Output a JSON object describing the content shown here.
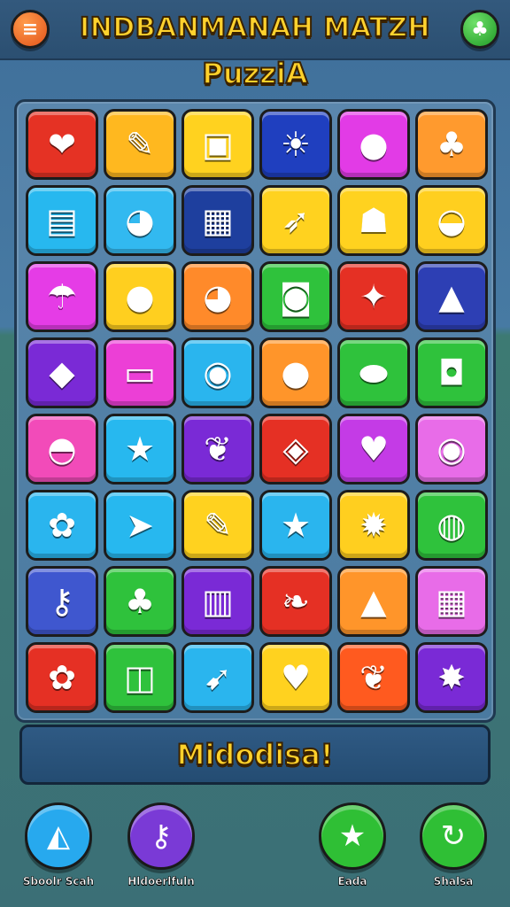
{
  "header": {
    "title": "INDBANMANAH MATZH",
    "subtitle": "PuzziA",
    "menu_icon": "≡",
    "profile_icon": "♣"
  },
  "board": {
    "tiles": [
      {
        "name": "heart-bow-icon",
        "glyph": "❤",
        "bg": "#e53224"
      },
      {
        "name": "pencil-icon",
        "glyph": "✎",
        "bg": "#ffb81f"
      },
      {
        "name": "camera-icon",
        "glyph": "▣",
        "bg": "#ffd21f"
      },
      {
        "name": "sun-icon",
        "glyph": "☀",
        "bg": "#1f3fbf"
      },
      {
        "name": "balloon-icon",
        "glyph": "●",
        "bg": "#e23be6"
      },
      {
        "name": "palm-tree-icon",
        "glyph": "♣",
        "bg": "#ff9a2e"
      },
      {
        "name": "treasure-box-icon",
        "glyph": "▤",
        "bg": "#27b8ef"
      },
      {
        "name": "fish-face-icon",
        "glyph": "◕",
        "bg": "#32b9f0"
      },
      {
        "name": "robot-head-icon",
        "glyph": "▦",
        "bg": "#1e3f9e"
      },
      {
        "name": "rocket-icon",
        "glyph": "➶",
        "bg": "#ffd21f"
      },
      {
        "name": "robot-icon",
        "glyph": "☗",
        "bg": "#ffd21f"
      },
      {
        "name": "melon-slice-icon",
        "glyph": "◒",
        "bg": "#ffcf1f"
      },
      {
        "name": "umbrella-icon",
        "glyph": "☂",
        "bg": "#e53ce6"
      },
      {
        "name": "bear-face-icon",
        "glyph": "●",
        "bg": "#ffcf1f"
      },
      {
        "name": "fish-face-icon",
        "glyph": "◕",
        "bg": "#ff8a2a"
      },
      {
        "name": "pot-icon",
        "glyph": "◙",
        "bg": "#2fc23c"
      },
      {
        "name": "star-sword-icon",
        "glyph": "✦",
        "bg": "#e53024"
      },
      {
        "name": "frog-icon",
        "glyph": "▲",
        "bg": "#2d3fb4"
      },
      {
        "name": "crystal-icon",
        "glyph": "◆",
        "bg": "#7a2ad6"
      },
      {
        "name": "tv-icon",
        "glyph": "▭",
        "bg": "#ec3fd6"
      },
      {
        "name": "fish-icon",
        "glyph": "◉",
        "bg": "#2ab5ee"
      },
      {
        "name": "balloon-icon",
        "glyph": "●",
        "bg": "#ff952a"
      },
      {
        "name": "capsule-icon",
        "glyph": "⬬",
        "bg": "#2fc23c"
      },
      {
        "name": "purse-icon",
        "glyph": "◘",
        "bg": "#2fc23c"
      },
      {
        "name": "frog-face-icon",
        "glyph": "◓",
        "bg": "#f24bb9"
      },
      {
        "name": "star-icon",
        "glyph": "★",
        "bg": "#27b8ef"
      },
      {
        "name": "leaf-icon",
        "glyph": "❦",
        "bg": "#7a2ad6"
      },
      {
        "name": "diamond-leaf-icon",
        "glyph": "◈",
        "bg": "#e53024"
      },
      {
        "name": "heart-icon",
        "glyph": "♥",
        "bg": "#c43be6"
      },
      {
        "name": "fish-icon",
        "glyph": "◉",
        "bg": "#e86ce8"
      },
      {
        "name": "key-flower-icon",
        "glyph": "✿",
        "bg": "#2ab5ee"
      },
      {
        "name": "paper-plane-icon",
        "glyph": "➤",
        "bg": "#27b8ef"
      },
      {
        "name": "pencil-ball-icon",
        "glyph": "✎",
        "bg": "#ffd21f"
      },
      {
        "name": "star-icon",
        "glyph": "★",
        "bg": "#2ab5ee"
      },
      {
        "name": "sun-icon",
        "glyph": "✹",
        "bg": "#ffcf1f"
      },
      {
        "name": "palette-icon",
        "glyph": "◍",
        "bg": "#2fc23c"
      },
      {
        "name": "key-icon",
        "glyph": "⚷",
        "bg": "#3f57cf"
      },
      {
        "name": "palm-tree-icon",
        "glyph": "♣",
        "bg": "#2fc23c"
      },
      {
        "name": "books-icon",
        "glyph": "▥",
        "bg": "#7a2ad6"
      },
      {
        "name": "feather-icon",
        "glyph": "❧",
        "bg": "#e53024"
      },
      {
        "name": "tree-icon",
        "glyph": "▲",
        "bg": "#ff952a"
      },
      {
        "name": "gift-box-icon",
        "glyph": "▦",
        "bg": "#e86ce8"
      },
      {
        "name": "flower-icon",
        "glyph": "✿",
        "bg": "#e53024"
      },
      {
        "name": "cup-icon",
        "glyph": "◫",
        "bg": "#2fc23c"
      },
      {
        "name": "carrot-icon",
        "glyph": "➹",
        "bg": "#2ab5ee"
      },
      {
        "name": "heart-leaf-icon",
        "glyph": "♥",
        "bg": "#ffd21f"
      },
      {
        "name": "leaf-icon",
        "glyph": "❦",
        "bg": "#ff5a1f"
      },
      {
        "name": "cheese-icon",
        "glyph": "✸",
        "bg": "#7a2ad6"
      }
    ]
  },
  "message": {
    "text": "Midodisa!"
  },
  "actions": [
    {
      "name": "sandwich-action",
      "glyph": "◭",
      "label": "Sboolr Scah",
      "bg": "#27a9ee"
    },
    {
      "name": "key-action",
      "glyph": "⚷",
      "label": "Hldoerlfuln",
      "bg": "#7a3ad6"
    },
    {
      "name": "star-action",
      "glyph": "★",
      "label": "Eada",
      "bg": "#2fbf35"
    },
    {
      "name": "refresh-action",
      "glyph": "↻",
      "label": "Shalsa",
      "bg": "#2fbf35"
    }
  ]
}
